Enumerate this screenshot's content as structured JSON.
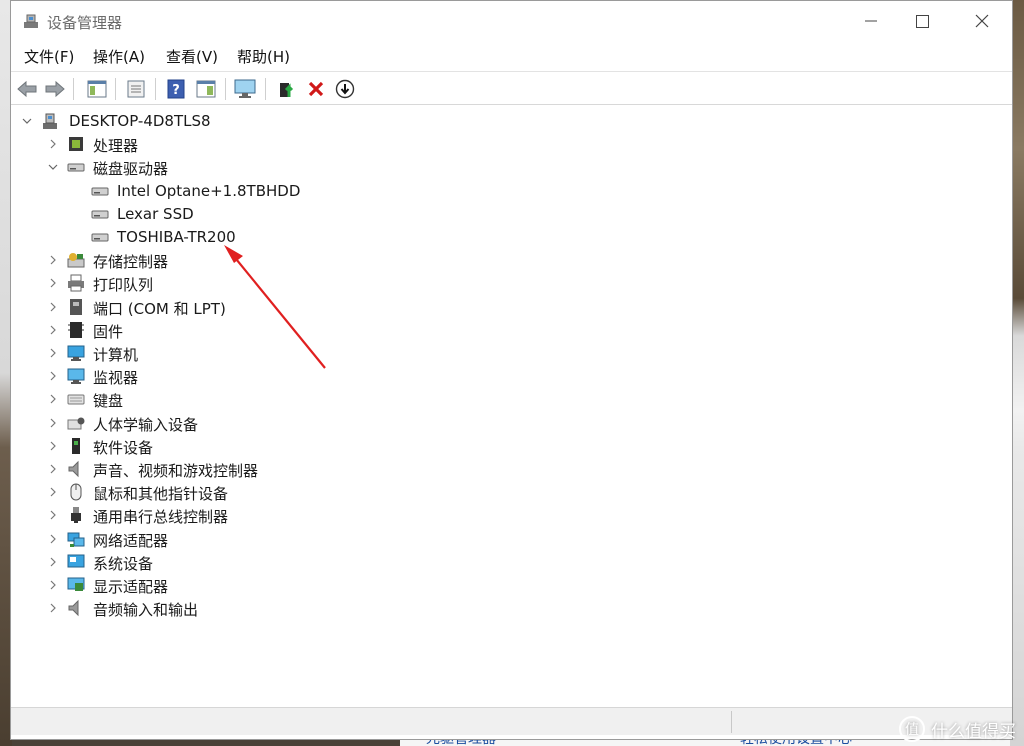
{
  "window": {
    "title": "设备管理器"
  },
  "menu": [
    "文件(F)",
    "操作(A)",
    "查看(V)",
    "帮助(H)"
  ],
  "tree": {
    "root": "DESKTOP-4D8TLS8",
    "categories": [
      {
        "label": "处理器",
        "icon": "cpu-icon",
        "expanded": false
      },
      {
        "label": "磁盘驱动器",
        "icon": "disk-drive-icon",
        "expanded": true,
        "children": [
          "Intel Optane+1.8TBHDD",
          "Lexar SSD",
          "TOSHIBA-TR200"
        ]
      },
      {
        "label": "存储控制器",
        "icon": "storage-controller-icon",
        "expanded": false
      },
      {
        "label": "打印队列",
        "icon": "printer-icon",
        "expanded": false
      },
      {
        "label": "端口 (COM 和 LPT)",
        "icon": "port-icon",
        "expanded": false
      },
      {
        "label": "固件",
        "icon": "firmware-icon",
        "expanded": false
      },
      {
        "label": "计算机",
        "icon": "computer-icon",
        "expanded": false
      },
      {
        "label": "监视器",
        "icon": "monitor-icon",
        "expanded": false
      },
      {
        "label": "键盘",
        "icon": "keyboard-icon",
        "expanded": false
      },
      {
        "label": "人体学输入设备",
        "icon": "hid-icon",
        "expanded": false
      },
      {
        "label": "软件设备",
        "icon": "software-device-icon",
        "expanded": false
      },
      {
        "label": "声音、视频和游戏控制器",
        "icon": "sound-icon",
        "expanded": false
      },
      {
        "label": "鼠标和其他指针设备",
        "icon": "mouse-icon",
        "expanded": false
      },
      {
        "label": "通用串行总线控制器",
        "icon": "usb-icon",
        "expanded": false
      },
      {
        "label": "网络适配器",
        "icon": "network-icon",
        "expanded": false
      },
      {
        "label": "系统设备",
        "icon": "system-device-icon",
        "expanded": false
      },
      {
        "label": "显示适配器",
        "icon": "display-adapter-icon",
        "expanded": false
      },
      {
        "label": "音频输入和输出",
        "icon": "audio-io-icon",
        "expanded": false
      }
    ]
  },
  "annotation": {
    "color": "#e02020",
    "target": "TOSHIBA-TR200"
  },
  "background_window": {
    "left_text": "光驱管理器",
    "right_text": "轻松使用设置中心"
  },
  "watermark": {
    "logo": "值",
    "text": "什么值得买"
  }
}
